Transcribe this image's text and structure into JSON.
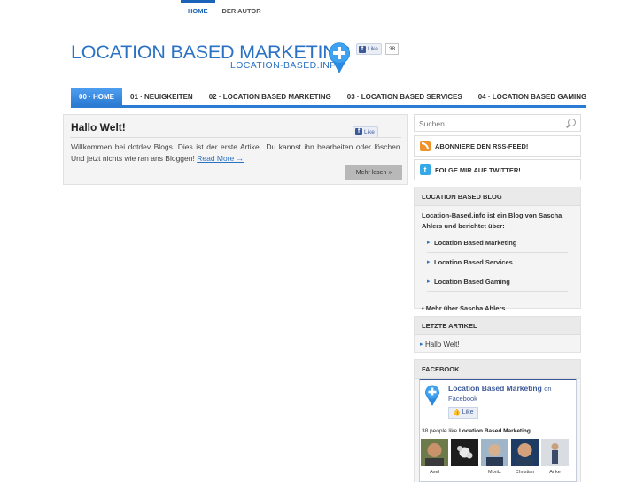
{
  "topnav": {
    "items": [
      "HOME",
      "DER AUTOR"
    ]
  },
  "logo": {
    "title": "LOCATION BASED MARKETING",
    "subtitle": "LOCATION-BASED.INFO"
  },
  "header_like": {
    "label": "Like",
    "count": "38"
  },
  "mainnav": {
    "items": [
      "00 · HOME",
      "01 · NEUIGKEITEN",
      "02 · LOCATION BASED MARKETING",
      "03 · LOCATION BASED SERVICES",
      "04 · LOCATION BASED GAMING"
    ]
  },
  "post": {
    "title": "Hallo Welt!",
    "like_label": "Like",
    "text": "Willkommen bei dotdev Blogs. Dies ist der erste Artikel. Du kannst ihn bearbeiten oder löschen. Und jetzt nichts wie ran ans Bloggen!",
    "read_more": "Read More →",
    "more_button": "Mehr lesen »"
  },
  "search": {
    "placeholder": "Suchen..."
  },
  "rss": {
    "label": "ABONNIERE DEN RSS-FEED!"
  },
  "twitter": {
    "label": "FOLGE MIR AUF TWITTER!"
  },
  "blog_widget": {
    "title": "LOCATION BASED BLOG",
    "intro": "Location-Based.info ist ein Blog von Sascha Ahlers und berichtet über:",
    "items": [
      "Location Based Marketing",
      "Location Based Services",
      "Location Based Gaming"
    ],
    "more": "• Mehr über Sascha Ahlers"
  },
  "latest_widget": {
    "title": "LETZTE ARTIKEL",
    "items": [
      "Hallo Welt!"
    ]
  },
  "facebook_widget": {
    "title": "FACEBOOK",
    "page_name": "Location Based Marketing",
    "on": "on",
    "facebook": "Facebook",
    "like_label": "Like",
    "people_count": "38 people like",
    "people_page": "Location Based Marketing.",
    "faces": [
      "Axel",
      "",
      "Moritz",
      "Christian",
      "Anke"
    ]
  },
  "colors": {
    "accent": "#2b7bd3",
    "logo": "#2a72c4",
    "facebook": "#3b5998"
  }
}
